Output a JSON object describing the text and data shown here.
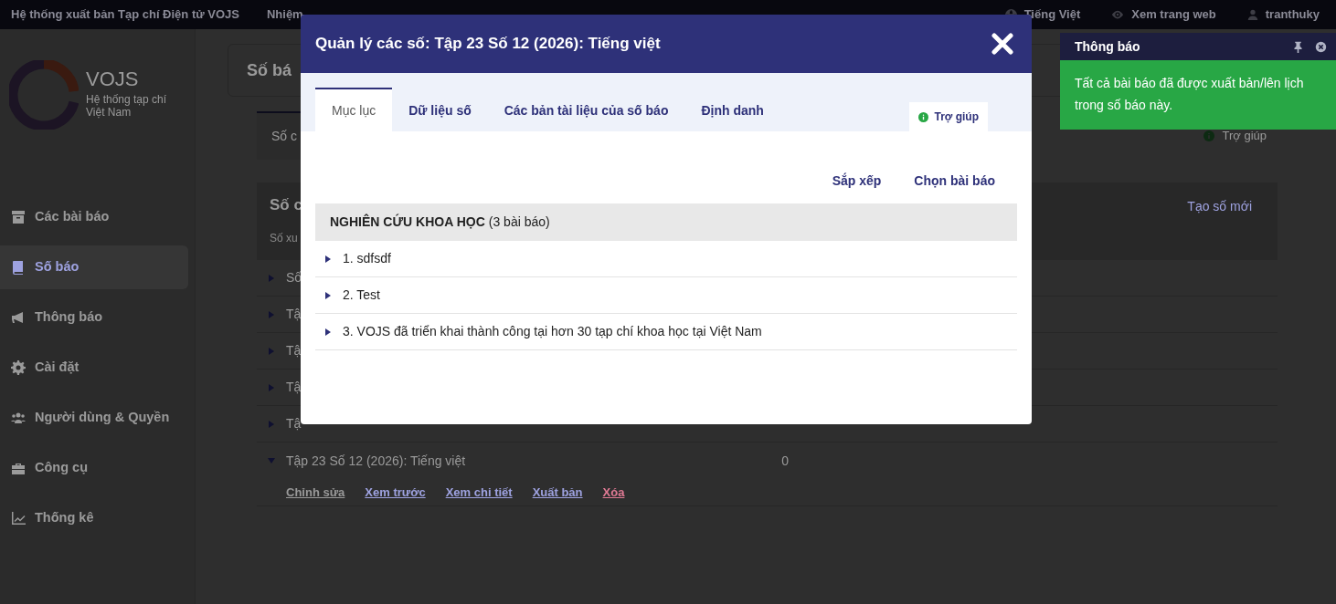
{
  "topbar": {
    "site_title": "Hệ thống xuất bản Tạp chí Điện tử VOJS",
    "tasks_label": "Nhiệm",
    "language": "Tiếng Việt",
    "view_site": "Xem trang web",
    "user": "tranthuky"
  },
  "logo": {
    "name": "VOJS",
    "tagline": "Hệ thống tạp chí Việt Nam"
  },
  "sidebar": {
    "items": [
      {
        "label": "Các bài báo",
        "selected": false
      },
      {
        "label": "Số báo",
        "selected": true
      },
      {
        "label": "Thông báo",
        "selected": false
      },
      {
        "label": "Cài đặt",
        "selected": false
      },
      {
        "label": "Người dùng & Quyền",
        "selected": false
      },
      {
        "label": "Công cụ",
        "selected": false
      },
      {
        "label": "Thống kê",
        "selected": false
      }
    ]
  },
  "page": {
    "title": "Số bá",
    "tabs": [
      {
        "label": "Số c",
        "selected": true
      }
    ],
    "help": "Trợ giúp",
    "panel_title": "Số c",
    "panel_subtitle": "Số xu",
    "create_button": "Tạo số mới",
    "issues": [
      {
        "title": "Số",
        "expanded": false
      },
      {
        "title": "Tậ",
        "expanded": false
      },
      {
        "title": "Tậ",
        "expanded": false
      },
      {
        "title": "Tậ",
        "expanded": false
      },
      {
        "title": "Tậ",
        "expanded": false
      },
      {
        "title": "Tập 23 Số 12 (2026): Tiếng việt",
        "count": "0",
        "expanded": true,
        "actions": [
          {
            "label": "Chỉnh sửa",
            "kind": "plain"
          },
          {
            "label": "Xem trước",
            "kind": "primary"
          },
          {
            "label": "Xem chi tiết",
            "kind": "primary"
          },
          {
            "label": "Xuất bản",
            "kind": "primary"
          },
          {
            "label": "Xóa",
            "kind": "danger"
          }
        ]
      }
    ]
  },
  "modal": {
    "title": "Quản lý các số: Tập 23 Số 12 (2026): Tiếng việt",
    "tabs": [
      {
        "label": "Mục lục",
        "selected": true
      },
      {
        "label": "Dữ liệu số",
        "selected": false
      },
      {
        "label": "Các bản tài liệu của số báo",
        "selected": false
      },
      {
        "label": "Định danh",
        "selected": false
      }
    ],
    "help": "Trợ giúp",
    "actions": [
      "Sắp xếp",
      "Chọn bài báo"
    ],
    "sections": [
      {
        "title": "NGHIÊN CỨU KHOA HỌC",
        "count": "(3 bài báo)",
        "articles": [
          {
            "title": "1. sdfsdf",
            "expanded": false
          },
          {
            "title": "2. Test",
            "expanded": false
          },
          {
            "title": "3. VOJS đã triển khai thành công tại hơn 30 tạp chí khoa học tại Việt Nam",
            "expanded": false
          }
        ]
      }
    ]
  },
  "toast": {
    "title": "Thông báo",
    "message": "Tất cả bài báo đã được xuất bản/lên lịch trong số báo này."
  }
}
